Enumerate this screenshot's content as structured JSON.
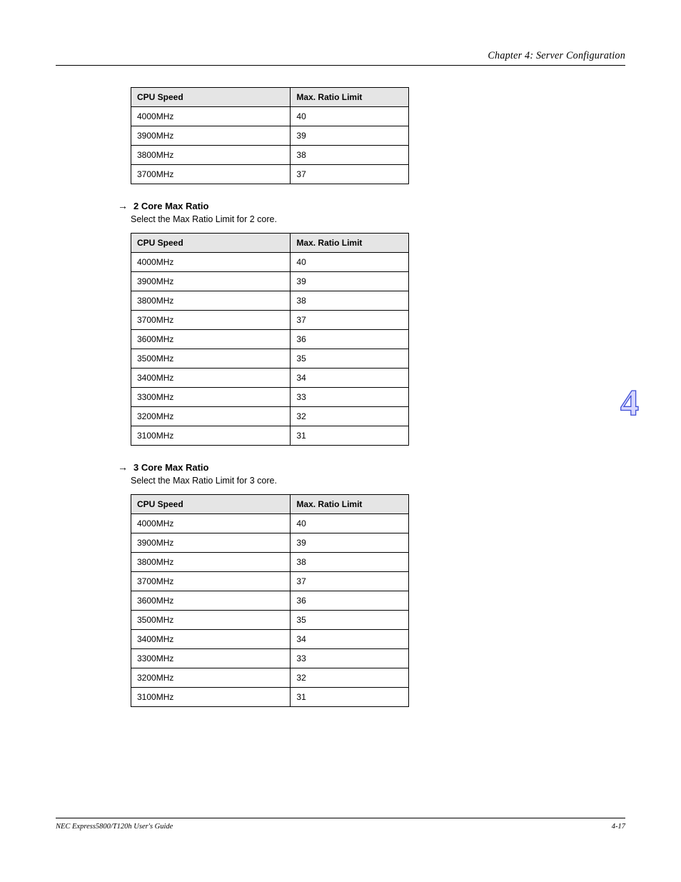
{
  "header": {
    "title": "Chapter 4: Server Configuration"
  },
  "tables": {
    "t1": {
      "headers": [
        "CPU Speed",
        "Max. Ratio Limit"
      ],
      "rows": [
        [
          "4000MHz",
          "40"
        ],
        [
          "3900MHz",
          "39"
        ],
        [
          "3800MHz",
          "38"
        ],
        [
          "3700MHz",
          "37"
        ]
      ]
    },
    "t2": {
      "headers": [
        "CPU Speed",
        "Max. Ratio Limit"
      ],
      "rows": [
        [
          "4000MHz",
          "40"
        ],
        [
          "3900MHz",
          "39"
        ],
        [
          "3800MHz",
          "38"
        ],
        [
          "3700MHz",
          "37"
        ],
        [
          "3600MHz",
          "36"
        ],
        [
          "3500MHz",
          "35"
        ],
        [
          "3400MHz",
          "34"
        ],
        [
          "3300MHz",
          "33"
        ],
        [
          "3200MHz",
          "32"
        ],
        [
          "3100MHz",
          "31"
        ]
      ]
    },
    "t3": {
      "headers": [
        "CPU Speed",
        "Max. Ratio Limit"
      ],
      "rows": [
        [
          "4000MHz",
          "40"
        ],
        [
          "3900MHz",
          "39"
        ],
        [
          "3800MHz",
          "38"
        ],
        [
          "3700MHz",
          "37"
        ],
        [
          "3600MHz",
          "36"
        ],
        [
          "3500MHz",
          "35"
        ],
        [
          "3400MHz",
          "34"
        ],
        [
          "3300MHz",
          "33"
        ],
        [
          "3200MHz",
          "32"
        ],
        [
          "3100MHz",
          "31"
        ]
      ]
    }
  },
  "sections": {
    "s2": {
      "title": "2 Core Max Ratio",
      "sub": "Select the Max Ratio Limit for 2 core."
    },
    "s3": {
      "title": "3 Core Max Ratio",
      "sub": "Select the Max Ratio Limit for 3 core."
    }
  },
  "sideChapter": "4",
  "footer": {
    "left": "NEC Express5800/T120h User's Guide",
    "right": "4-17"
  }
}
